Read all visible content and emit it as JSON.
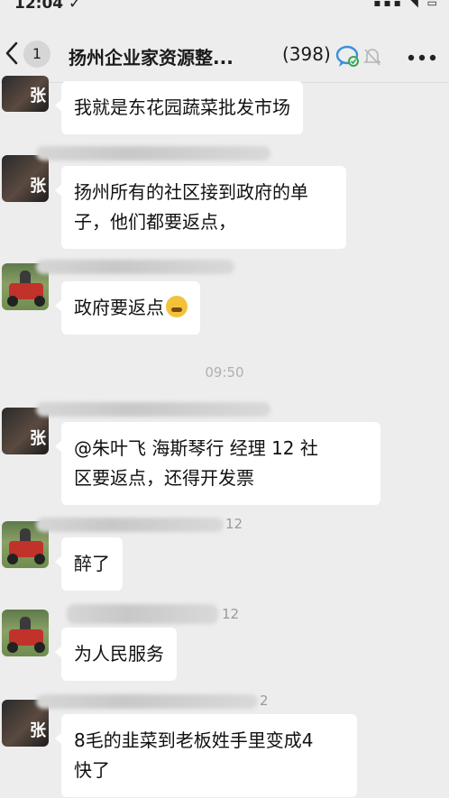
{
  "status_bar": {
    "time": "12:04 ✓",
    "icons": "▪▪▪ ◥ ▭"
  },
  "header": {
    "unread_count": "1",
    "title": "扬州企业家资源整...",
    "member_count": "(398)",
    "icons": [
      "back-icon",
      "voice-icon",
      "mute-icon",
      "more-icon"
    ]
  },
  "messages": [
    {
      "avatar": "zhang",
      "text_lines": [
        "我就是东花园蔬菜批发市场"
      ]
    },
    {
      "avatar": "zhang",
      "text_lines": [
        "扬州所有的社区接到政府的单",
        "子，他们都要返点，"
      ]
    },
    {
      "avatar": "mower",
      "text_lines": [
        "政府要返点"
      ],
      "emoji": "crying-face"
    },
    {
      "avatar": "zhang",
      "text_lines": [
        "@朱叶飞 海斯琴行  经理  12 社",
        "区要返点，还得开发票"
      ]
    },
    {
      "avatar": "mower",
      "name_suffix": "12",
      "text_lines": [
        "醉了"
      ]
    },
    {
      "avatar": "mower",
      "name_suffix": "12",
      "text_lines": [
        "为人民服务"
      ]
    },
    {
      "avatar": "zhang",
      "name_suffix": "2",
      "text_lines": [
        "8毛的韭菜到老板姓手里变成4",
        "快了"
      ]
    }
  ],
  "timestamp": "09:50"
}
